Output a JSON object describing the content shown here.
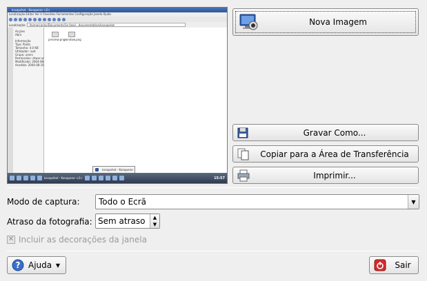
{
  "buttons": {
    "new_image": "Nova Imagem",
    "save_as": "Gravar Como...",
    "copy_clipboard": "Copiar para a Área de Transferência",
    "print": "Imprimir...",
    "help": "Ajuda",
    "quit": "Sair"
  },
  "capture_mode": {
    "label": "Modo de captura:",
    "value": "Todo o Ecrã"
  },
  "delay": {
    "label": "Atraso da fotografia:",
    "value": "Sem atraso"
  },
  "window_decorations": {
    "label": "Incluir as decorações da janela",
    "checked": true,
    "enabled": false
  },
  "preview": {
    "window_title": "knsapshot - Konqueror <2>",
    "menu": "Localização  Editar  Ver  Ir  Favoritos  Ferramentas  Configuração  Janela  Ajuda",
    "location_label": "Localização:",
    "location_value": "/home/carlos/Documents/2a fase/...documentation/ksnapshot",
    "panel_lines": [
      "Acções",
      "Abrir",
      "Informação",
      "Tipo: Pasta",
      "Tamanho: 4.0 KB",
      "Utilizador: root",
      "Grupo: users",
      "Permissões: drwxr-xr-x",
      "Modificado: 2004-08-10 17:27",
      "Acedido: 2004-08-10 17:27"
    ],
    "files": [
      "preview.png",
      "window.png"
    ],
    "tab": "ksnapshot - Konqueror",
    "taskbar_task": "ksnapshot - Konqueror <2>",
    "clock": "15:57"
  },
  "icons": {
    "new_image": "monitor-camera-icon",
    "save_as": "floppy-disk-icon",
    "copy": "copy-document-icon",
    "print": "printer-icon",
    "help": "question-icon",
    "quit": "power-exit-icon"
  }
}
